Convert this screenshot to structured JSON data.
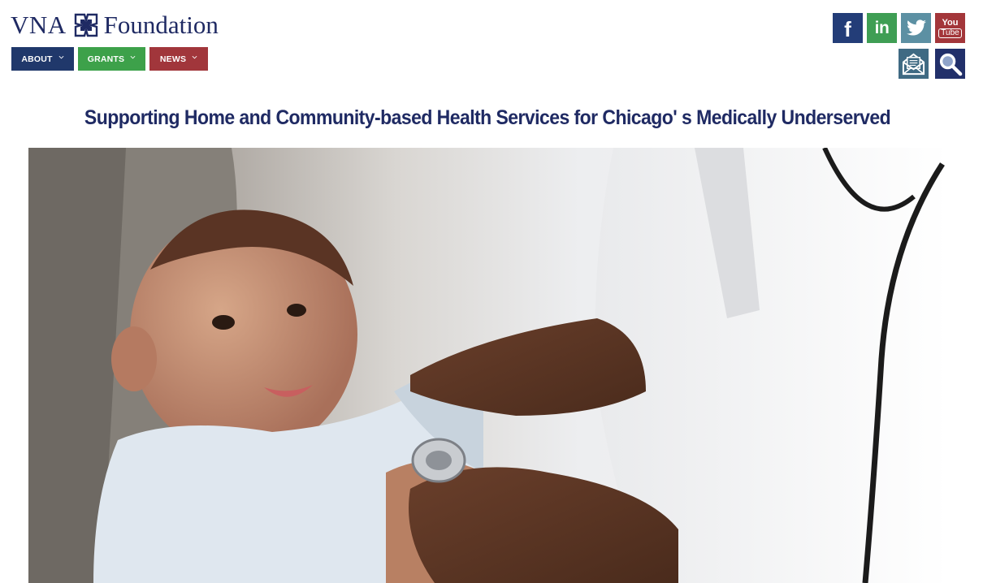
{
  "logo": {
    "left_text": "VNA",
    "right_text": "Foundation"
  },
  "nav": {
    "items": [
      {
        "label": "ABOUT",
        "color": "#20386b"
      },
      {
        "label": "GRANTS",
        "color": "#3da14a"
      },
      {
        "label": "NEWS",
        "color": "#a1363b"
      }
    ]
  },
  "social": {
    "facebook": {
      "icon": "facebook-icon",
      "glyph": "f",
      "color": "#233d78"
    },
    "linkedin": {
      "icon": "linkedin-icon",
      "glyph": "in",
      "color": "#3f9e54"
    },
    "twitter": {
      "icon": "twitter-icon",
      "color": "#5c90a3"
    },
    "youtube": {
      "icon": "youtube-icon",
      "glyph_top": "You",
      "glyph_bottom": "Tube",
      "color": "#a3363a"
    }
  },
  "utility": {
    "newsletter": {
      "icon": "envelope-icon",
      "color": "#3f6a83"
    },
    "search": {
      "icon": "search-icon",
      "color": "#22306a"
    }
  },
  "tagline": "Supporting Home and Community-based Health Services for Chicago' s Medically Underserved",
  "colors": {
    "brand_navy": "#1f2a63"
  }
}
